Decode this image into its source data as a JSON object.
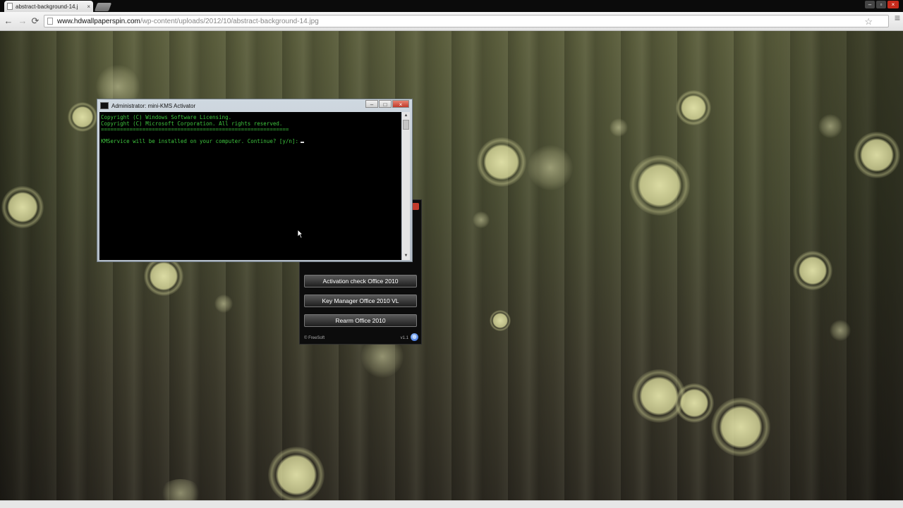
{
  "browser": {
    "tab_title": "abstract-background-14.j",
    "tab_close": "×",
    "url_domain": "www.hdwallpaperspin.com",
    "url_path": "/wp-content/uploads/2012/10/abstract-background-14.jpg",
    "window_controls": {
      "minimize": "–",
      "maximize": "▫",
      "close": "×"
    },
    "nav": {
      "back": "←",
      "forward": "→",
      "reload": "⟳"
    }
  },
  "console": {
    "title": "Administrator: mini-KMS Activator",
    "controls": {
      "minimize": "–",
      "maximize": "□",
      "close": "×"
    },
    "lines": [
      "Copyright (C) Windows Software Licensing.",
      "Copyright (C) Microsoft Corporation. All rights reserved.",
      "===========================================================",
      "KMService will be installed on your computer. Continue? [y/n]:"
    ]
  },
  "kms_gui": {
    "buttons": [
      "Activation check Office 2010",
      "Key Manager Office 2010 VL",
      "Rearm Office 2010"
    ],
    "footer_left": "© FreeSoft",
    "footer_right": "v1.1"
  }
}
